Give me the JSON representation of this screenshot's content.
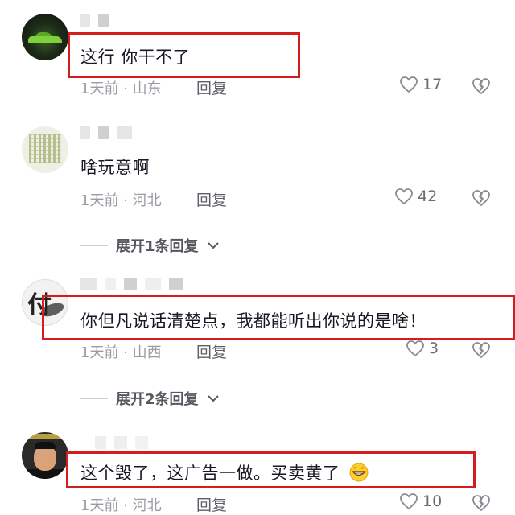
{
  "comments": [
    {
      "text": "这行 你干不了",
      "location": "1天前 · 山东",
      "reply_label": "回复",
      "likes": "17",
      "avatar_icon": "sports-car-avatar"
    },
    {
      "text": "啥玩意啊",
      "location": "1天前 · 河北",
      "reply_label": "回复",
      "likes": "42",
      "avatar_icon": "text-grid-avatar",
      "expand_label": "展开1条回复"
    },
    {
      "text": "你但凡说话清楚点，我都能听出你说的是啥！",
      "location": "1天前 · 山西",
      "reply_label": "回复",
      "likes": "3",
      "avatar_icon": "calligraphy-avatar",
      "expand_label": "展开2条回复"
    },
    {
      "text": "这个毁了，这广告一做。买卖黄了",
      "location": "1天前 · 河北",
      "reply_label": "回复",
      "likes": "10",
      "avatar_icon": "man-portrait-avatar",
      "emoji": "grinning-face-emoji"
    }
  ],
  "colors": {
    "highlight_border": "#d41d1d",
    "meta_text": "#9b9ca3",
    "body_text": "#161823"
  }
}
